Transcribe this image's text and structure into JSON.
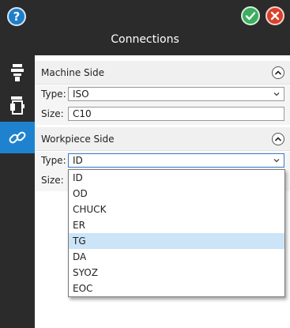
{
  "window": {
    "title": "Connections"
  },
  "toolbar": {
    "help_label": "?"
  },
  "machine_side": {
    "title": "Machine Side",
    "type_label": "Type:",
    "type_value": "ISO",
    "size_label": "Size:",
    "size_value": "C10"
  },
  "workpiece_side": {
    "title": "Workpiece Side",
    "type_label": "Type:",
    "type_value": "ID",
    "size_label": "Size:",
    "options": [
      "ID",
      "OD",
      "CHUCK",
      "ER",
      "TG",
      "DA",
      "SYOZ",
      "EOC"
    ],
    "hovered_option": "TG"
  },
  "colors": {
    "accent": "#1f82cf",
    "ok": "#3cae5f",
    "cancel": "#d9412a",
    "hover": "#cce4f7"
  },
  "icons": {
    "help": "help-icon",
    "ok": "checkmark-icon",
    "cancel": "close-icon",
    "sidebar": [
      "tool-holder-icon",
      "tool-assembly-icon",
      "connection-link-icon"
    ]
  }
}
